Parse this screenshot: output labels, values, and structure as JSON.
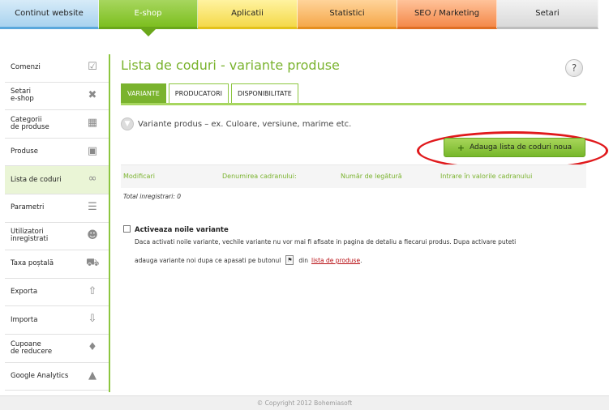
{
  "topnav": {
    "tabs": [
      {
        "label": "Continut website"
      },
      {
        "label": "E-shop"
      },
      {
        "label": "Aplicatii"
      },
      {
        "label": "Statistici"
      },
      {
        "label": "SEO / Marketing"
      },
      {
        "label": "Setari"
      }
    ],
    "active_index": 1
  },
  "sidebar": {
    "items": [
      {
        "label": "Comenzi",
        "icon": "clipboard-check-icon"
      },
      {
        "label": "Setari\ne-shop",
        "icon": "tools-icon"
      },
      {
        "label": "Categorii\nde produse",
        "icon": "boxes-icon"
      },
      {
        "label": "Produse",
        "icon": "product-icon"
      },
      {
        "label": "Lista de coduri",
        "icon": "binoculars-icon"
      },
      {
        "label": "Parametri",
        "icon": "sliders-icon"
      },
      {
        "label": "Utilizatori\ninregistrati",
        "icon": "users-icon"
      },
      {
        "label": "Taxa poștală",
        "icon": "delivery-truck-icon"
      },
      {
        "label": "Exporta",
        "icon": "export-icon"
      },
      {
        "label": "Importa",
        "icon": "import-icon"
      },
      {
        "label": "Cupoane\nde reducere",
        "icon": "coupon-tag-icon"
      },
      {
        "label": "Google Analytics",
        "icon": "analytics-chart-icon"
      }
    ],
    "active_index": 4
  },
  "main": {
    "title": "Lista de coduri - variante produse",
    "help_label": "?",
    "subtabs": [
      {
        "label": "VARIANTE"
      },
      {
        "label": "PRODUCATORI"
      },
      {
        "label": "DISPONIBILITATE"
      }
    ],
    "info_text": "Variante produs – ex. Culoare, versiune, marime etc.",
    "add_button_label": "Adauga lista de coduri noua",
    "table": {
      "columns": [
        "Modificari",
        "Denumirea cadranului:",
        "Număr de legătură",
        "Intrare în valorile cadranului"
      ]
    },
    "total_text": "Total inregistrari: 0",
    "activate": {
      "title": "Activeaza noile variante",
      "checked": false,
      "desc1": "Daca activati noile variante, vechile variante nu vor mai fi afisate in pagina de detaliu a fiecarui produs. Dupa activare puteti",
      "desc2_pre": "adauga variante noi dupa ce apasati pe butonul",
      "desc2_mid": "din",
      "desc2_link": "lista de produse",
      "desc2_end": "."
    }
  },
  "footer": {
    "text": "© Copyright 2012 Bohemiasoft"
  },
  "colors": {
    "accent_green": "#7ab32e",
    "highlight_red": "#e0191c",
    "link_red": "#b80f14"
  }
}
